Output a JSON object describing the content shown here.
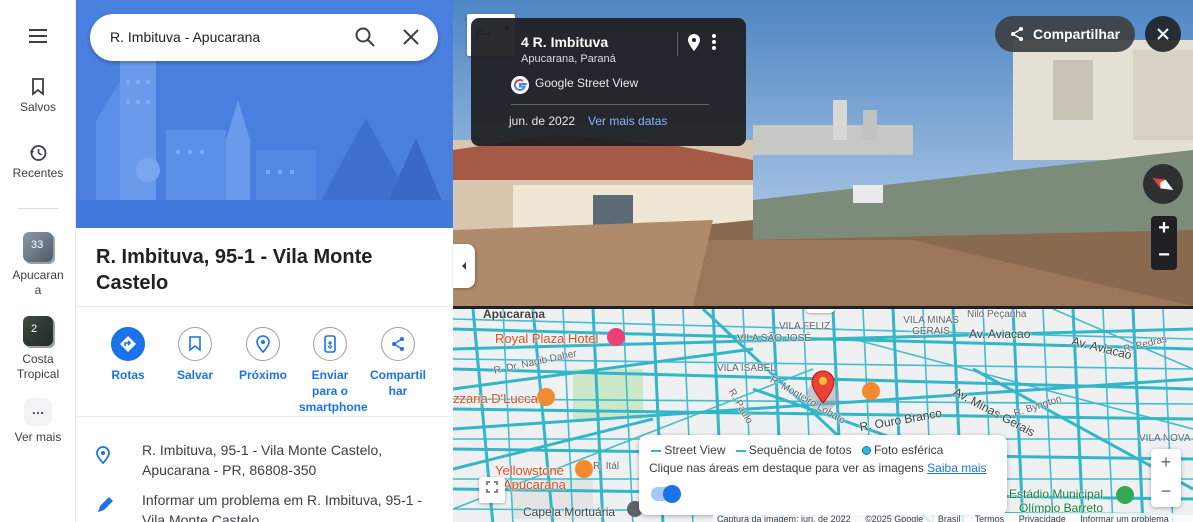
{
  "rail": {
    "saved_label": "Salvos",
    "recent_label": "Recentes",
    "recent_places": [
      {
        "label": "Apucarana",
        "count": "33"
      },
      {
        "label": "Costa Tropical",
        "count": "2"
      }
    ],
    "more_label": "Ver mais",
    "more_dots": "…"
  },
  "search": {
    "value": "R. Imbituva - Apucarana"
  },
  "place": {
    "title": "R. Imbituva, 95-1 - Vila Monte Castelo",
    "address": "R. Imbituva, 95-1 - Vila Monte Castelo, Apucarana - PR, 86808-350",
    "report": "Informar um problema em R. Imbituva, 95-1 - Vila Monte Castelo"
  },
  "actions": {
    "routes": "Rotas",
    "save": "Salvar",
    "nearby": "Próximo",
    "send": "Enviar para o smartphone",
    "share": "Compartilhar"
  },
  "streetview": {
    "address": "4 R. Imbituva",
    "city": "Apucarana, Paraná",
    "source": "Google Street View",
    "date": "jun. de 2022",
    "more_dates": "Ver mais datas",
    "share_label": "Compartilhar",
    "peg_label": "P+"
  },
  "map": {
    "labels": {
      "apucarana": "Apucarana",
      "royal": "Royal Plaza Hotel",
      "vila_feliz": "VILA FELIZ",
      "vila_minas_gerais": "VILA MINAS GERAIS",
      "av_aviacao": "Av. Aviacao",
      "av_aviacao2": "Av. Aviacao",
      "vila_sao_jose": "VILA SÃO JOSÉ",
      "nagib": "R. Dr. Nagib Daher",
      "vila_isabel": "VILA ISABEL",
      "pizzaria": "zzaria D'Lucca",
      "monteiro": "R. Monteiro Lobato",
      "ouro_branco": "R. Ouro Branco",
      "av_minas": "Av. Minas Gerais",
      "yellowstone": "Yellowstone",
      "apucarana_poi": "Apucarana",
      "capela": "Capela Mortuária",
      "estadio": "Estádio Municipal",
      "olimpio": "Olímpio Barreto",
      "vila_nova": "VILA NOVA",
      "pecanha": "Nilo Peçanha",
      "italia": "R. Itál",
      "byngton": "R. Byngton",
      "paulo": "R. Paulo",
      "pedras": "R. Pedras"
    },
    "legend": {
      "street_view": "Street View",
      "photo_sequence": "Sequência de fotos",
      "spherical": "Foto esférica",
      "hint": "Clique nas áreas em destaque para ver as imagens",
      "learn_more": "Saiba mais"
    },
    "footer": {
      "capture": "Captura da imagem: jun. de 2022",
      "copyright": "©2025 Google",
      "country": "Brasil",
      "terms": "Termos",
      "privacy": "Privacidade",
      "report": "Informar um problema"
    }
  },
  "colors": {
    "accent": "#1a73e8",
    "road": "#33b6c8",
    "hero": "#4a7fe0"
  }
}
